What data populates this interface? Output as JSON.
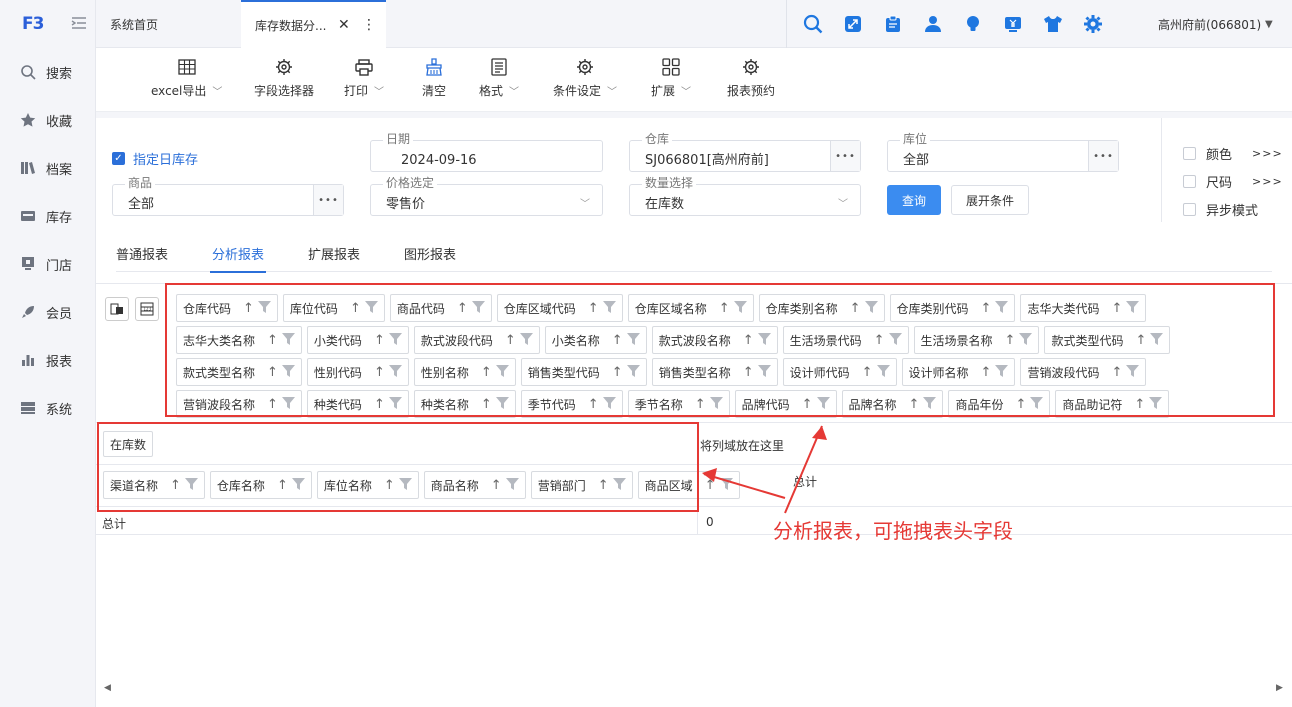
{
  "app": {
    "logo_text": "F3",
    "menu_toggle": "☰"
  },
  "sidebar": {
    "items": [
      {
        "label": "搜索",
        "icon": "search-icon"
      },
      {
        "label": "收藏",
        "icon": "star-icon"
      },
      {
        "label": "档案",
        "icon": "books-icon"
      },
      {
        "label": "库存",
        "icon": "inventory-icon"
      },
      {
        "label": "门店",
        "icon": "store-icon"
      },
      {
        "label": "会员",
        "icon": "rocket-icon"
      },
      {
        "label": "报表",
        "icon": "bar-chart-icon"
      },
      {
        "label": "系统",
        "icon": "server-icon"
      }
    ]
  },
  "tabs": {
    "home": "系统首页",
    "active": "库存数据分...",
    "close": "✕",
    "more": "⋮"
  },
  "user": {
    "name": "高州府前(066801)"
  },
  "toolbar": {
    "excel": "excel导出",
    "field_selector": "字段选择器",
    "print": "打印",
    "clear": "清空",
    "format": "格式",
    "condition": "条件设定",
    "extend": "扩展",
    "schedule": "报表预约"
  },
  "filters": {
    "specified_date_stock": "指定日库存",
    "date_label": "日期",
    "date_value": "2024-09-16",
    "warehouse_label": "仓库",
    "warehouse_value": "SJ066801[高州府前]",
    "location_label": "库位",
    "location_value": "全部",
    "product_label": "商品",
    "product_value": "全部",
    "price_label": "价格选定",
    "price_value": "零售价",
    "qty_label": "数量选择",
    "qty_value": "在库数",
    "dots": "•••",
    "query_btn": "查询",
    "expand_btn": "展开条件",
    "color": "颜色",
    "size": "尺码",
    "async": "异步模式",
    "arrows": ">>>"
  },
  "report_tabs": {
    "normal": "普通报表",
    "analysis": "分析报表",
    "extend": "扩展报表",
    "graph": "图形报表"
  },
  "pivot": {
    "available_fields": [
      "仓库代码",
      "库位代码",
      "商品代码",
      "仓库区域代码",
      "仓库区域名称",
      "仓库类别名称",
      "仓库类别代码",
      "志华大类代码",
      "志华大类名称",
      "小类代码",
      "款式波段代码",
      "小类名称",
      "款式波段名称",
      "生活场景代码",
      "生活场景名称",
      "款式类型代码",
      "款式类型名称",
      "性别代码",
      "性别名称",
      "销售类型代码",
      "销售类型名称",
      "设计师代码",
      "设计师名称",
      "营销波段代码",
      "营销波段名称",
      "种类代码",
      "种类名称",
      "季节代码",
      "季节名称",
      "品牌代码",
      "品牌名称",
      "商品年份",
      "商品助记符"
    ],
    "data_field": "在库数",
    "row_fields": [
      "渠道名称",
      "仓库名称",
      "库位名称",
      "商品名称",
      "营销部门",
      "商品区域"
    ],
    "column_drop_hint": "将列域放在这里",
    "total_header": "总计",
    "row_total": "总计",
    "row_total_value": "0"
  },
  "annotation": "分析报表，可拖拽表头字段"
}
